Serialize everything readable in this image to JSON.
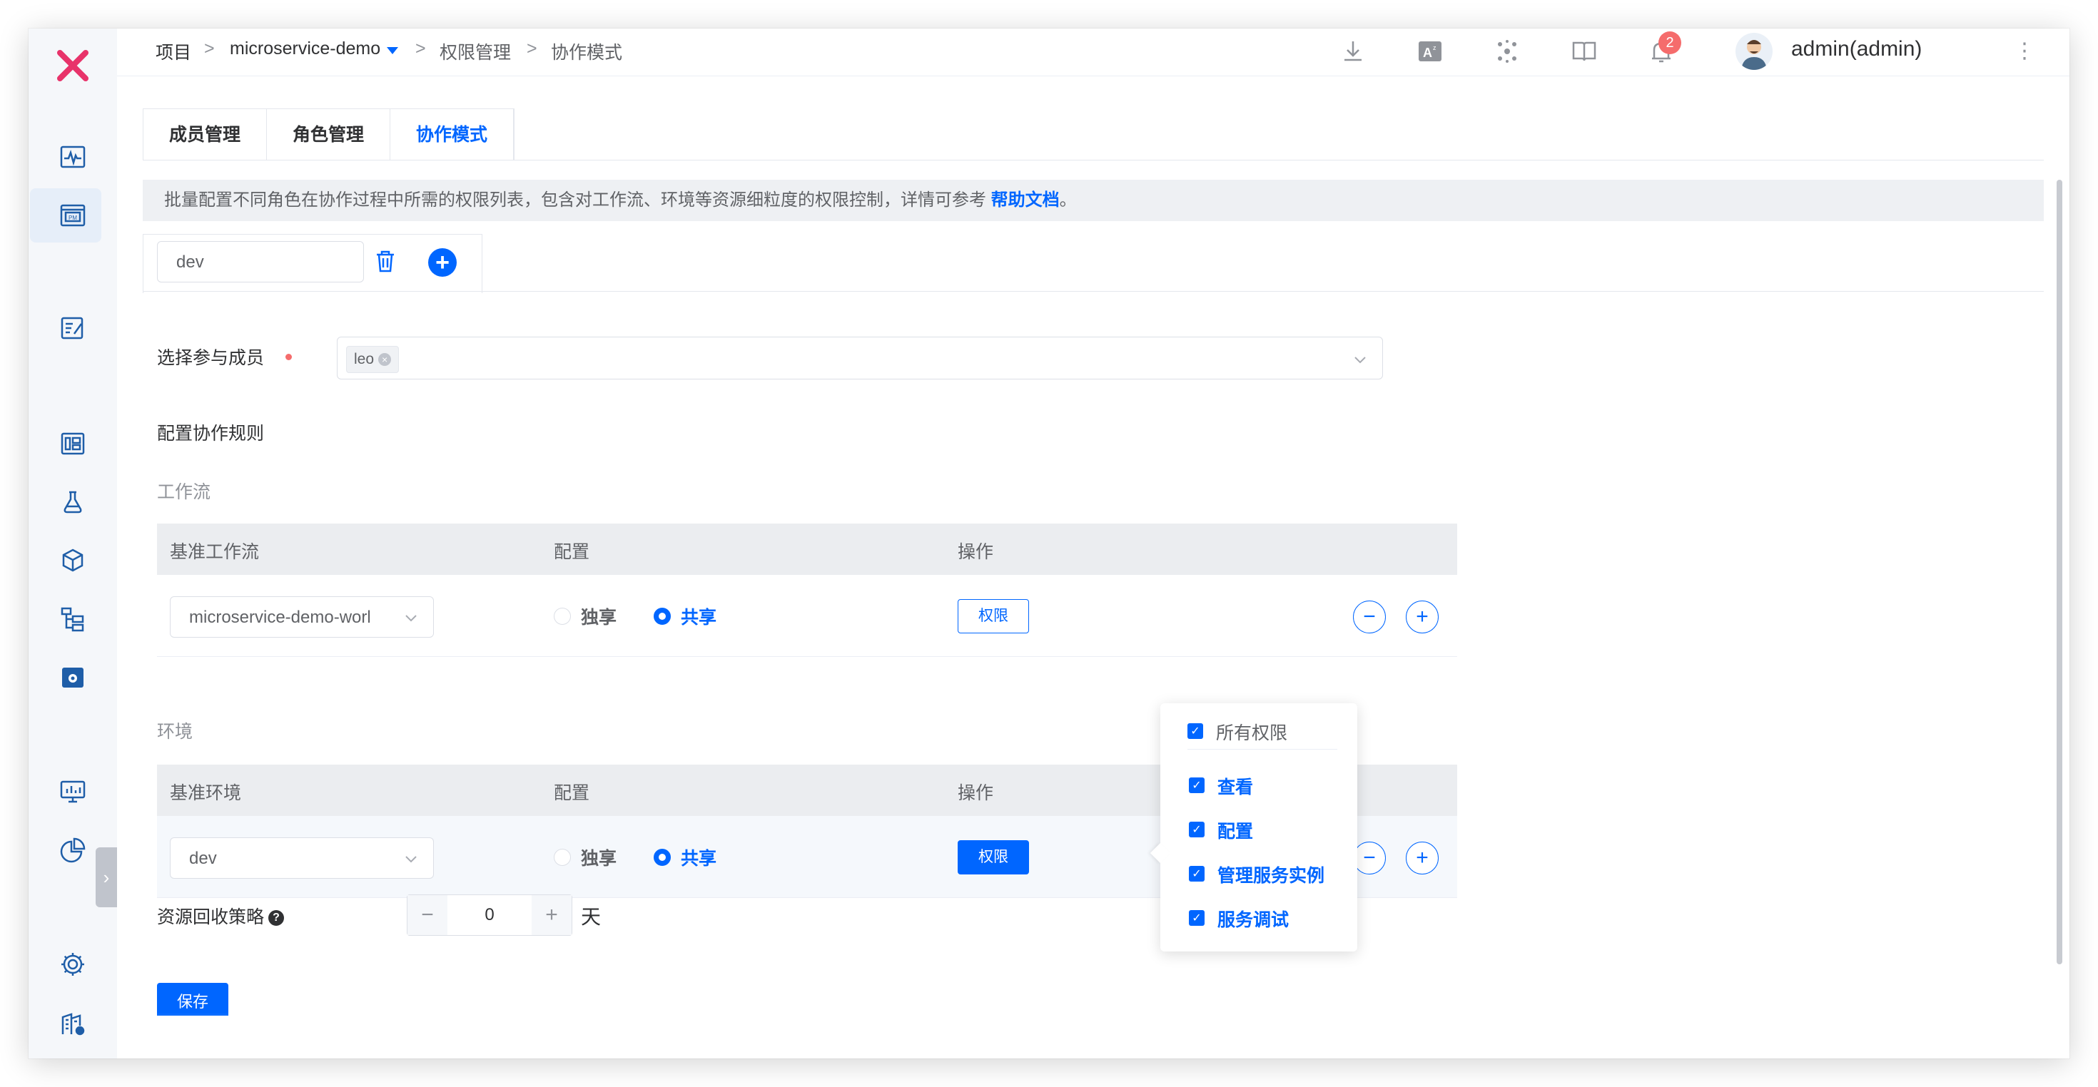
{
  "breadcrumb": {
    "project": "项目",
    "sep": ">",
    "project_name": "microservice-demo",
    "section": "权限管理",
    "current": "协作模式"
  },
  "topbar": {
    "notification_count": "2",
    "user": "admin(admin)",
    "more": "⋮",
    "icons": [
      "download-icon",
      "translate-icon",
      "cluster-icon",
      "book-icon",
      "bell-icon"
    ]
  },
  "tabs": [
    "成员管理",
    "角色管理",
    "协作模式"
  ],
  "info": {
    "text": "批量配置不同角色在协作过程中所需的权限列表，包含对工作流、环境等资源细粒度的权限控制，详情可参考 ",
    "link": "帮助文档",
    "suffix": "。"
  },
  "role": {
    "value": "dev",
    "add": "+"
  },
  "members": {
    "label": "选择参与成员",
    "tags": [
      "leo"
    ]
  },
  "rules_label": "配置协作规则",
  "workflow": {
    "section": "工作流",
    "headers": [
      "基准工作流",
      "配置",
      "操作"
    ],
    "row": {
      "select": "microservice-demo-worl",
      "exclusive": "独享",
      "shared": "共享",
      "perm": "权限"
    }
  },
  "environment": {
    "section": "环境",
    "headers": [
      "基准环境",
      "配置",
      "操作"
    ],
    "row": {
      "select": "dev",
      "exclusive": "独享",
      "shared": "共享",
      "perm": "权限"
    }
  },
  "popover": {
    "all": "所有权限",
    "items": [
      "查看",
      "配置",
      "管理服务实例",
      "服务调试"
    ]
  },
  "recycle": {
    "label": "资源回收策略",
    "help": "?",
    "value": "0",
    "unit": "天",
    "minus": "−",
    "plus": "+"
  },
  "save_label": "保存",
  "colors": {
    "primary": "#0066ff",
    "badge": "#f56c6c",
    "logo": "#e8336a"
  }
}
